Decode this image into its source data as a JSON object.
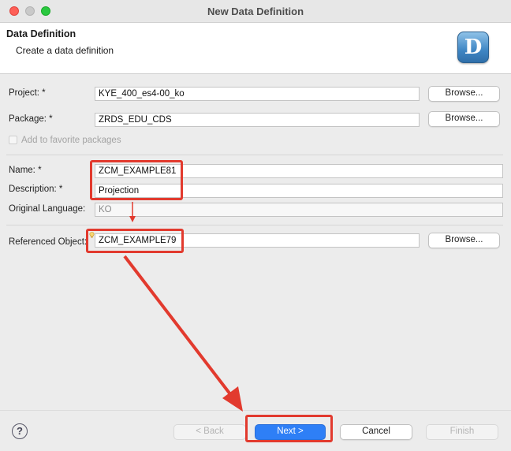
{
  "window": {
    "title": "New Data Definition"
  },
  "header": {
    "title": "Data Definition",
    "description": "Create a data definition",
    "logo_letter": "D"
  },
  "form": {
    "project": {
      "label": "Project: *",
      "value": "KYE_400_es4-00_ko",
      "browse": "Browse..."
    },
    "package": {
      "label": "Package: *",
      "value": "ZRDS_EDU_CDS",
      "browse": "Browse..."
    },
    "favorite": {
      "label": "Add to favorite packages"
    },
    "name": {
      "label": "Name: *",
      "value": "ZCM_EXAMPLE81"
    },
    "description": {
      "label": "Description: *",
      "value": "Projection"
    },
    "original_language": {
      "label": "Original Language:",
      "value": "KO"
    },
    "referenced_object": {
      "label": "Referenced Object:",
      "value": "ZCM_EXAMPLE79",
      "browse": "Browse..."
    }
  },
  "footer": {
    "help": "?",
    "back": "< Back",
    "next": "Next >",
    "cancel": "Cancel",
    "finish": "Finish"
  },
  "colors": {
    "annotation": "#e23a2e",
    "primary": "#2e7ff6"
  },
  "icons": [
    "help-icon",
    "content-assist-icon",
    "data-definition-logo"
  ]
}
